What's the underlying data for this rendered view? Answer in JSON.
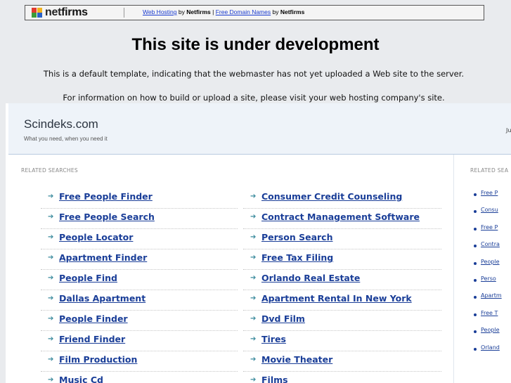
{
  "topbar": {
    "logo_net": "net",
    "logo_firms": "firms",
    "link1": "Web Hosting",
    "by1": "by",
    "brand1": "Netfirms",
    "divider": "|",
    "link2": "Free Domain Names",
    "by2": "by",
    "brand2": "Netfirms",
    "logo_colors": [
      "#e23b2f",
      "#f2b320",
      "#3b9c3a",
      "#2a62c9"
    ]
  },
  "headline": "This site is under development",
  "message1": "This is a default template, indicating that the webmaster has not yet uploaded a Web site to the server.",
  "message2": "For information on how to build or upload a site, please visit your web hosting company's site.",
  "site": {
    "title": "Scindeks.com",
    "tagline": "What you need, when you need it",
    "right_text": "Ju"
  },
  "main": {
    "label": "RELATED SEARCHES",
    "col_a": [
      "Free People Finder",
      "Free People Search",
      "People Locator",
      "Apartment Finder",
      "People Find",
      "Dallas Apartment",
      "People Finder",
      "Friend Finder",
      "Film Production",
      "Music Cd"
    ],
    "col_b": [
      "Consumer Credit Counseling",
      "Contract Management Software",
      "Person Search",
      "Free Tax Filing",
      "Orlando Real Estate",
      "Apartment Rental In New York",
      "Dvd Film",
      "Tires",
      "Movie Theater",
      "Films"
    ]
  },
  "side": {
    "label": "RELATED SEA",
    "items": [
      "Free P",
      "Consu",
      "Free P",
      "Contra",
      "People",
      "Perso",
      "Apartm",
      "Free T",
      "People",
      "Orland"
    ]
  }
}
